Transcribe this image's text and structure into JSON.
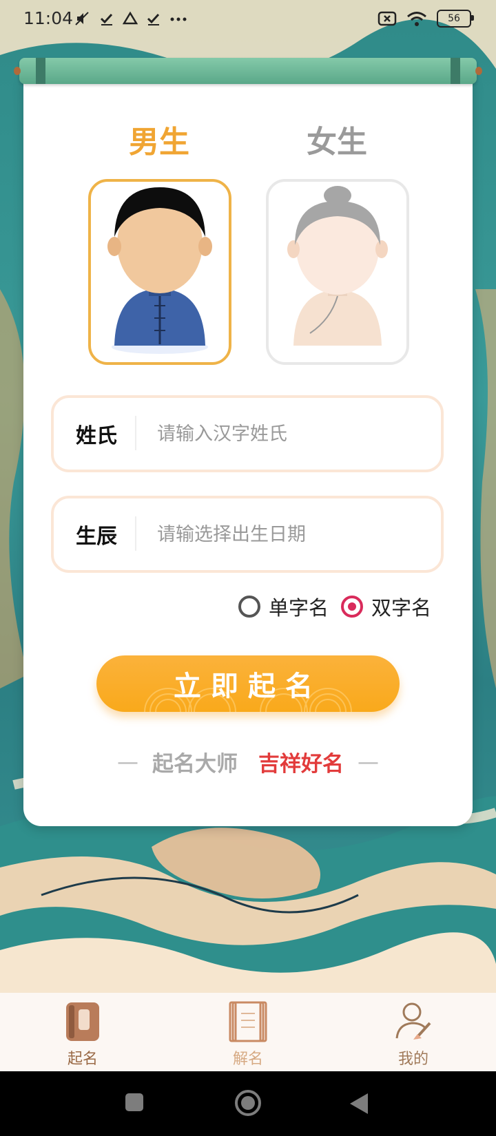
{
  "status_bar": {
    "time": "11:04",
    "battery": "56",
    "left_icons": [
      "mute-icon",
      "check-icon",
      "drive-icon",
      "check-icon",
      "more-icon"
    ],
    "right_icons": [
      "close-box-icon",
      "wifi-icon",
      "battery-icon"
    ]
  },
  "gender": {
    "male_label": "男生",
    "female_label": "女生",
    "selected": "male"
  },
  "form": {
    "surname_label": "姓氏",
    "surname_placeholder": "请输入汉字姓氏",
    "birth_label": "生辰",
    "birth_placeholder": "请输选择出生日期"
  },
  "name_type": {
    "single_label": "单字名",
    "double_label": "双字名",
    "selected": "double"
  },
  "submit_label": "立即起名",
  "slogan": {
    "part1": "起名大师",
    "part2": "吉祥好名",
    "dash": "—"
  },
  "tabs": [
    {
      "label": "起名",
      "icon": "book-icon",
      "active": true
    },
    {
      "label": "解名",
      "icon": "scroll-icon",
      "active": false
    },
    {
      "label": "我的",
      "icon": "user-brush-icon",
      "active": false
    }
  ],
  "colors": {
    "accent_orange": "#f0a533",
    "radio_selected": "#d92b5b",
    "slogan_red": "#e23b3b"
  }
}
